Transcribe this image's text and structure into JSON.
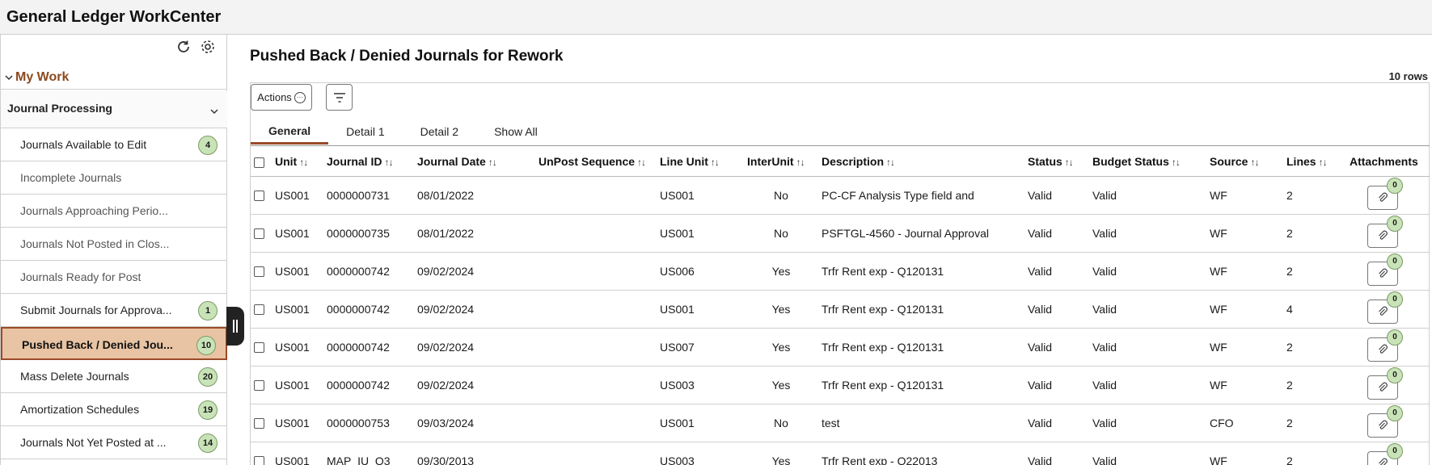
{
  "app": {
    "title": "General Ledger WorkCenter"
  },
  "sidebar": {
    "my_work_label": "My Work",
    "section_label": "Journal Processing",
    "items": [
      {
        "label": "Journals Available to Edit",
        "badge": "4"
      },
      {
        "label": "Incomplete Journals",
        "badge": ""
      },
      {
        "label": "Journals Approaching Perio...",
        "badge": ""
      },
      {
        "label": "Journals Not Posted in Clos...",
        "badge": ""
      },
      {
        "label": "Journals Ready for Post",
        "badge": ""
      },
      {
        "label": "Submit Journals for Approva...",
        "badge": "1"
      },
      {
        "label": "Pushed Back / Denied Jou...",
        "badge": "10"
      },
      {
        "label": "Mass Delete Journals",
        "badge": "20"
      },
      {
        "label": "Amortization Schedules",
        "badge": "19"
      },
      {
        "label": "Journals Not Yet Posted at ...",
        "badge": "14"
      }
    ]
  },
  "main": {
    "title": "Pushed Back / Denied Journals for Rework",
    "rows_count": "10 rows",
    "actions_label": "Actions",
    "tabs": [
      {
        "label": "General"
      },
      {
        "label": "Detail 1"
      },
      {
        "label": "Detail 2"
      },
      {
        "label": "Show All"
      }
    ],
    "columns": {
      "unit": "Unit",
      "journal_id": "Journal ID",
      "journal_date": "Journal Date",
      "unpost_sequence": "UnPost Sequence",
      "line_unit": "Line Unit",
      "interunit": "InterUnit",
      "description": "Description",
      "status": "Status",
      "budget_status": "Budget Status",
      "source": "Source",
      "lines": "Lines",
      "attachments": "Attachments"
    },
    "rows": [
      {
        "unit": "US001",
        "journal_id": "0000000731",
        "journal_date": "08/01/2022",
        "line_unit": "US001",
        "interunit": "No",
        "description": "PC-CF Analysis Type field and",
        "status": "Valid",
        "budget_status": "Valid",
        "source": "WF",
        "lines": "2",
        "attachments": "0"
      },
      {
        "unit": "US001",
        "journal_id": "0000000735",
        "journal_date": "08/01/2022",
        "line_unit": "US001",
        "interunit": "No",
        "description": "PSFTGL-4560 - Journal Approval",
        "status": "Valid",
        "budget_status": "Valid",
        "source": "WF",
        "lines": "2",
        "attachments": "0"
      },
      {
        "unit": "US001",
        "journal_id": "0000000742",
        "journal_date": "09/02/2024",
        "line_unit": "US006",
        "interunit": "Yes",
        "description": "Trfr Rent exp - Q120131",
        "status": "Valid",
        "budget_status": "Valid",
        "source": "WF",
        "lines": "2",
        "attachments": "0"
      },
      {
        "unit": "US001",
        "journal_id": "0000000742",
        "journal_date": "09/02/2024",
        "line_unit": "US001",
        "interunit": "Yes",
        "description": "Trfr Rent exp - Q120131",
        "status": "Valid",
        "budget_status": "Valid",
        "source": "WF",
        "lines": "4",
        "attachments": "0"
      },
      {
        "unit": "US001",
        "journal_id": "0000000742",
        "journal_date": "09/02/2024",
        "line_unit": "US007",
        "interunit": "Yes",
        "description": "Trfr Rent exp - Q120131",
        "status": "Valid",
        "budget_status": "Valid",
        "source": "WF",
        "lines": "2",
        "attachments": "0"
      },
      {
        "unit": "US001",
        "journal_id": "0000000742",
        "journal_date": "09/02/2024",
        "line_unit": "US003",
        "interunit": "Yes",
        "description": "Trfr Rent exp - Q120131",
        "status": "Valid",
        "budget_status": "Valid",
        "source": "WF",
        "lines": "2",
        "attachments": "0"
      },
      {
        "unit": "US001",
        "journal_id": "0000000753",
        "journal_date": "09/03/2024",
        "line_unit": "US001",
        "interunit": "No",
        "description": "test",
        "status": "Valid",
        "budget_status": "Valid",
        "source": "CFO",
        "lines": "2",
        "attachments": "0"
      },
      {
        "unit": "US001",
        "journal_id": "MAP_IU_Q3",
        "journal_date": "09/30/2013",
        "line_unit": "US003",
        "interunit": "Yes",
        "description": "Trfr Rent exp - Q22013",
        "status": "Valid",
        "budget_status": "Valid",
        "source": "WF",
        "lines": "2",
        "attachments": "0"
      }
    ]
  },
  "colors": {
    "accent": "#9b4a2a",
    "active_bg": "#e8c4a4",
    "badge_bg": "#c9e3b8",
    "link": "#1c5a8c"
  },
  "icons": [
    "refresh-icon",
    "gear-icon",
    "chevron-down-icon",
    "filter-icon",
    "paperclip-icon",
    "more-icon",
    "sort-icon"
  ]
}
